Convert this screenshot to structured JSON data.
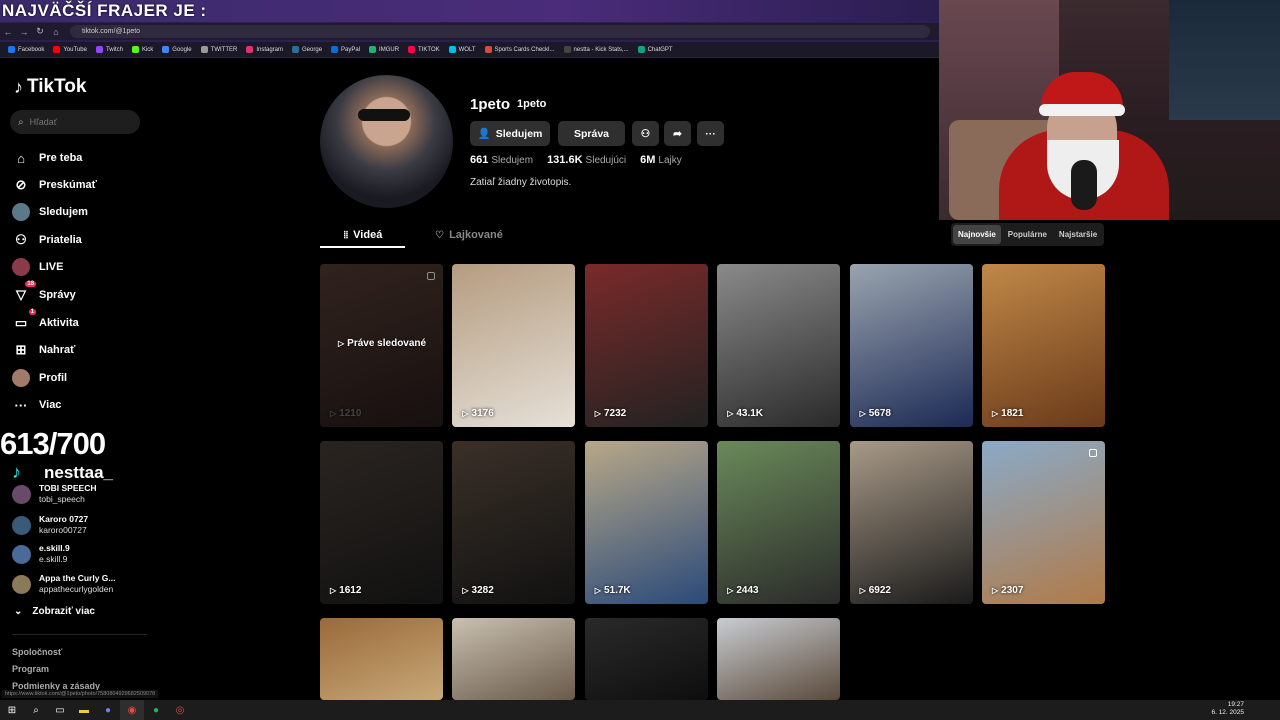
{
  "overlay": {
    "title": "NAJVÄČŠÍ FRAJER JE :",
    "counter": "613/700",
    "streamer_name": "nesttaa_"
  },
  "browser": {
    "url": "tiktok.com/@1peto",
    "bookmarks": [
      "Facebook",
      "YouTube",
      "Twitch",
      "Kick",
      "Google",
      "TWITTER",
      "Instagram",
      "George",
      "PayPal",
      "IMGUR",
      "TIKTOK",
      "WOLT",
      "Sports Cards Checkl...",
      "nestta - Kick Stats,...",
      "ChatGPT"
    ],
    "status_url": "https://www.tiktok.com/@1peto/photo/7580804929682509078"
  },
  "sidebar": {
    "logo": "TikTok",
    "search_placeholder": "Hľadať",
    "items": [
      {
        "label": "Pre teba",
        "icon": "home-icon"
      },
      {
        "label": "Preskúmať",
        "icon": "compass-icon"
      },
      {
        "label": "Sledujem",
        "icon": "following-avatar-icon"
      },
      {
        "label": "Priatelia",
        "icon": "friends-icon"
      },
      {
        "label": "LIVE",
        "icon": "live-icon"
      },
      {
        "label": "Správy",
        "icon": "messages-icon",
        "badge": "18"
      },
      {
        "label": "Aktivita",
        "icon": "activity-icon",
        "badge": "1"
      },
      {
        "label": "Nahrať",
        "icon": "upload-icon"
      },
      {
        "label": "Profil",
        "icon": "profile-icon"
      },
      {
        "label": "Viac",
        "icon": "more-icon"
      }
    ],
    "following_accounts": [
      {
        "name": "TOBI SPEECH",
        "handle": "tobi_speech"
      },
      {
        "name": "Karoro 0727",
        "handle": "karoro00727"
      },
      {
        "name": "e.skill.9",
        "handle": "e.skill.9"
      },
      {
        "name": "Appa the Curly G...",
        "handle": "appathecurlygolden"
      }
    ],
    "show_more": "Zobraziť viac",
    "footer": [
      "Spoločnosť",
      "Program",
      "Podmienky a zásady"
    ]
  },
  "profile": {
    "username": "1peto",
    "nickname": "1peto",
    "follow_button": "Sledujem",
    "message_button": "Správa",
    "stats": [
      {
        "value": "661",
        "label": "Sledujem"
      },
      {
        "value": "131.6K",
        "label": "Sledujúci"
      },
      {
        "value": "6M",
        "label": "Lajky"
      }
    ],
    "bio": "Zatiaľ žiadny životopis.",
    "tabs": [
      "Videá",
      "Lajkované"
    ],
    "sort_options": [
      "Najnovšie",
      "Populárne",
      "Najstaršie"
    ]
  },
  "videos": [
    {
      "views": "1210",
      "watched_label": "Práve sledované",
      "pinned": true,
      "colors": [
        "#5a4038",
        "#2a1e1c"
      ]
    },
    {
      "views": "3176",
      "colors": [
        "#b59c80",
        "#e5e0d8"
      ]
    },
    {
      "views": "7232",
      "colors": [
        "#7a2a2a",
        "#222"
      ]
    },
    {
      "views": "43.1K",
      "colors": [
        "#8a8a8a",
        "#2a2a2a"
      ]
    },
    {
      "views": "5678",
      "colors": [
        "#9aa4ae",
        "#1c2a55"
      ]
    },
    {
      "views": "1821",
      "colors": [
        "#c08848",
        "#6a3a1a"
      ]
    },
    {
      "views": "1612",
      "colors": [
        "#2a2420",
        "#111"
      ]
    },
    {
      "views": "3282",
      "colors": [
        "#3a3028",
        "#111"
      ]
    },
    {
      "views": "51.7K",
      "colors": [
        "#b8a888",
        "#2a4a7a"
      ]
    },
    {
      "views": "2443",
      "colors": [
        "#6a8a5a",
        "#2a2a2a"
      ]
    },
    {
      "views": "6922",
      "colors": [
        "#a89a88",
        "#1a1a1a"
      ]
    },
    {
      "views": "2307",
      "pinned": true,
      "colors": [
        "#8aaac8",
        "#b07a48"
      ]
    },
    {
      "views": "",
      "colors": [
        "#9a6a3a",
        "#c8a878"
      ]
    },
    {
      "views": "",
      "colors": [
        "#c8c0b0",
        "#6a5a4a"
      ]
    },
    {
      "views": "",
      "colors": [
        "#2a2a2a",
        "#0e0e0e"
      ]
    },
    {
      "views": "",
      "colors": [
        "#c8ccd2",
        "#5a4a3a"
      ]
    }
  ],
  "taskbar": {
    "time": "19:27",
    "date": "6. 12. 2025"
  }
}
